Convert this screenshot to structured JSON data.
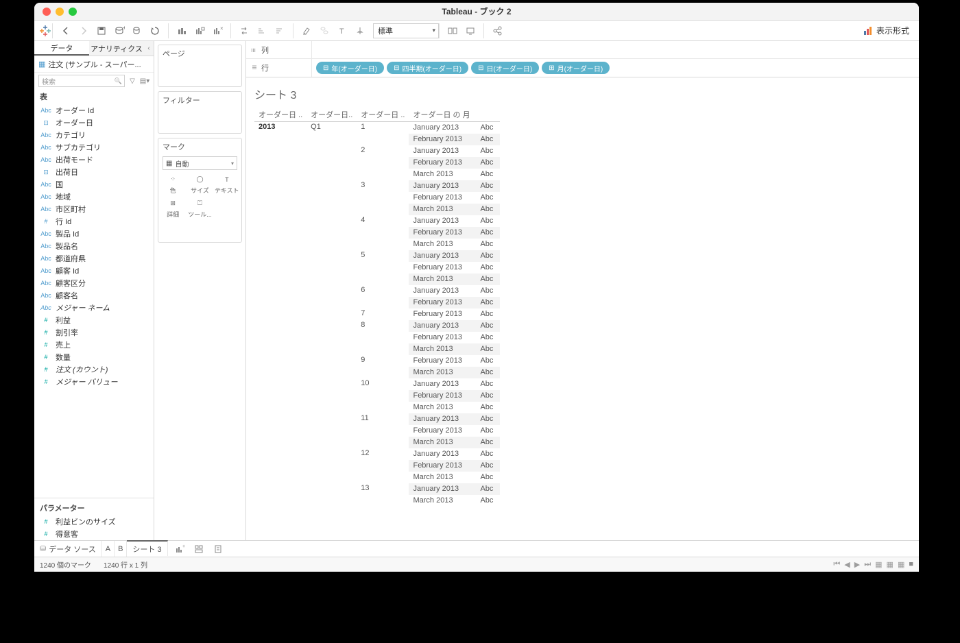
{
  "window": {
    "title": "Tableau - ブック 2"
  },
  "toolbar": {
    "fitmode": "標準",
    "showme": "表示形式"
  },
  "side": {
    "tab_data": "データ",
    "tab_analytics": "アナリティクス",
    "datasource": "注文 (サンプル - スーパー...",
    "search_placeholder": "検索",
    "section_table": "表",
    "section_params": "パラメーター",
    "fields": [
      {
        "type": "Abc",
        "cls": "dim",
        "label": "オーダー Id"
      },
      {
        "type": "date",
        "cls": "dim",
        "label": "オーダー日"
      },
      {
        "type": "Abc",
        "cls": "dim",
        "label": "カテゴリ"
      },
      {
        "type": "Abc",
        "cls": "dim",
        "label": "サブカテゴリ"
      },
      {
        "type": "Abc",
        "cls": "dim",
        "label": "出荷モード"
      },
      {
        "type": "date",
        "cls": "dim",
        "label": "出荷日"
      },
      {
        "type": "Abc",
        "cls": "dim",
        "label": "国"
      },
      {
        "type": "Abc",
        "cls": "dim",
        "label": "地域"
      },
      {
        "type": "Abc",
        "cls": "dim",
        "label": "市区町村"
      },
      {
        "type": "#",
        "cls": "dim",
        "label": "行 Id"
      },
      {
        "type": "Abc",
        "cls": "dim",
        "label": "製品 Id"
      },
      {
        "type": "Abc",
        "cls": "dim",
        "label": "製品名"
      },
      {
        "type": "Abc",
        "cls": "dim",
        "label": "都道府県"
      },
      {
        "type": "Abc",
        "cls": "dim",
        "label": "顧客 Id"
      },
      {
        "type": "Abc",
        "cls": "dim",
        "label": "顧客区分"
      },
      {
        "type": "Abc",
        "cls": "dim",
        "label": "顧客名"
      },
      {
        "type": "Abc",
        "cls": "dim",
        "label": "メジャー ネーム",
        "italic": true
      },
      {
        "type": "#",
        "cls": "meas",
        "label": "利益"
      },
      {
        "type": "#",
        "cls": "meas",
        "label": "割引率"
      },
      {
        "type": "#",
        "cls": "meas",
        "label": "売上"
      },
      {
        "type": "#",
        "cls": "meas",
        "label": "数量"
      },
      {
        "type": "#",
        "cls": "meas",
        "label": "注文 (カウント)",
        "italic": true
      },
      {
        "type": "#",
        "cls": "meas",
        "label": "メジャー バリュー",
        "italic": true
      }
    ],
    "params": [
      {
        "type": "#",
        "cls": "meas",
        "label": "利益ビンのサイズ"
      },
      {
        "type": "#",
        "cls": "meas",
        "label": "得意客"
      }
    ]
  },
  "shelf": {
    "pages": "ページ",
    "filters": "フィルター",
    "marks": "マーク",
    "auto": "自動",
    "cells": [
      {
        "icon": "color",
        "label": "色"
      },
      {
        "icon": "size",
        "label": "サイズ"
      },
      {
        "icon": "text",
        "label": "テキスト"
      },
      {
        "icon": "detail",
        "label": "詳細"
      },
      {
        "icon": "tooltip",
        "label": "ツール..."
      }
    ]
  },
  "colrow": {
    "columns": "列",
    "rows": "行",
    "pills": [
      "年(オーダー日)",
      "四半期(オーダー日)",
      "日(オーダー日)",
      "月(オーダー日)"
    ]
  },
  "view": {
    "title": "シート 3",
    "headers": [
      "オーダー日 ..",
      "オーダー日..",
      "オーダー日 ..",
      "オーダー日 の 月",
      ""
    ],
    "year": "2013",
    "quarter": "Q1",
    "rows": [
      {
        "d": "1",
        "alt": false,
        "months": [
          [
            "January 2013",
            "Abc",
            false
          ],
          [
            "February 2013",
            "Abc",
            true
          ]
        ]
      },
      {
        "d": "2",
        "alt": true,
        "months": [
          [
            "January 2013",
            "Abc",
            false
          ],
          [
            "February 2013",
            "Abc",
            true
          ],
          [
            "March 2013",
            "Abc",
            false
          ]
        ]
      },
      {
        "d": "3",
        "alt": false,
        "months": [
          [
            "January 2013",
            "Abc",
            true
          ],
          [
            "February 2013",
            "Abc",
            false
          ],
          [
            "March 2013",
            "Abc",
            true
          ]
        ]
      },
      {
        "d": "4",
        "alt": true,
        "months": [
          [
            "January 2013",
            "Abc",
            false
          ],
          [
            "February 2013",
            "Abc",
            true
          ],
          [
            "March 2013",
            "Abc",
            false
          ]
        ]
      },
      {
        "d": "5",
        "alt": false,
        "months": [
          [
            "January 2013",
            "Abc",
            true
          ],
          [
            "February 2013",
            "Abc",
            false
          ],
          [
            "March 2013",
            "Abc",
            true
          ]
        ]
      },
      {
        "d": "6",
        "alt": true,
        "months": [
          [
            "January 2013",
            "Abc",
            false
          ],
          [
            "February 2013",
            "Abc",
            true
          ]
        ]
      },
      {
        "d": "7",
        "alt": false,
        "months": [
          [
            "February 2013",
            "Abc",
            false
          ]
        ]
      },
      {
        "d": "8",
        "alt": true,
        "months": [
          [
            "January 2013",
            "Abc",
            true
          ],
          [
            "February 2013",
            "Abc",
            false
          ],
          [
            "March 2013",
            "Abc",
            true
          ]
        ]
      },
      {
        "d": "9",
        "alt": false,
        "months": [
          [
            "February 2013",
            "Abc",
            false
          ],
          [
            "March 2013",
            "Abc",
            true
          ]
        ]
      },
      {
        "d": "10",
        "alt": true,
        "months": [
          [
            "January 2013",
            "Abc",
            false
          ],
          [
            "February 2013",
            "Abc",
            true
          ],
          [
            "March 2013",
            "Abc",
            false
          ]
        ]
      },
      {
        "d": "11",
        "alt": false,
        "months": [
          [
            "January 2013",
            "Abc",
            true
          ],
          [
            "February 2013",
            "Abc",
            false
          ],
          [
            "March 2013",
            "Abc",
            true
          ]
        ]
      },
      {
        "d": "12",
        "alt": true,
        "months": [
          [
            "January 2013",
            "Abc",
            false
          ],
          [
            "February 2013",
            "Abc",
            true
          ],
          [
            "March 2013",
            "Abc",
            false
          ]
        ]
      },
      {
        "d": "13",
        "alt": false,
        "months": [
          [
            "January 2013",
            "Abc",
            true
          ],
          [
            "March 2013",
            "Abc",
            false
          ]
        ]
      }
    ]
  },
  "tabs": {
    "datasource": "データ ソース",
    "items": [
      "A",
      "B",
      "シート 3"
    ]
  },
  "status": {
    "marks": "1240 個のマーク",
    "dims": "1240 行 x 1 列"
  }
}
